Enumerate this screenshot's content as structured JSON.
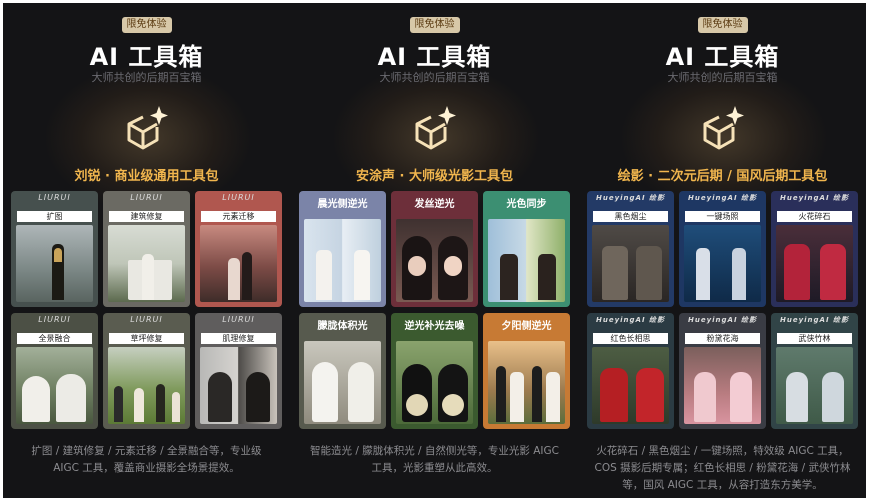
{
  "panels": [
    {
      "badge": "限免体验",
      "title": "AI 工具箱",
      "subtitle": "大师共创的后期百宝箱",
      "package": "刘锐 · 商业级通用工具包",
      "brand": "LIURUI",
      "cards": [
        {
          "label": "扩图"
        },
        {
          "label": "建筑修复"
        },
        {
          "label": "元素迁移"
        },
        {
          "label": "全景融合"
        },
        {
          "label": "草坪修复"
        },
        {
          "label": "肌理修复"
        }
      ],
      "description": "扩图 / 建筑修复 / 元素迁移 / 全景融合等，专业级 AIGC 工具，覆盖商业摄影全场景提效。"
    },
    {
      "badge": "限免体验",
      "title": "AI 工具箱",
      "subtitle": "大师共创的后期百宝箱",
      "package": "安涂声 · 大师级光影工具包",
      "cards": [
        {
          "label": "晨光侧逆光"
        },
        {
          "label": "发丝逆光"
        },
        {
          "label": "光色同步"
        },
        {
          "label": "朦胧体积光"
        },
        {
          "label": "逆光补光去噪"
        },
        {
          "label": "夕阳侧逆光"
        }
      ],
      "description": "智能造光 / 朦胧体积光 / 自然侧光等，专业光影 AIGC 工具，光影重塑从此高效。"
    },
    {
      "badge": "限免体验",
      "title": "AI 工具箱",
      "subtitle": "大师共创的后期百宝箱",
      "package": "绘影 · 二次元后期 / 国风后期工具包",
      "brand": "HueyingAI 绘影",
      "cards": [
        {
          "label": "黑色烟尘"
        },
        {
          "label": "一键场照"
        },
        {
          "label": "火花碎石"
        },
        {
          "label": "红色长相思"
        },
        {
          "label": "粉黛花海"
        },
        {
          "label": "武侠竹林"
        }
      ],
      "description": "火花碎石 / 黑色烟尘 / 一键场照，特效级 AIGC 工具，COS 摄影后期专属；红色长相思 / 粉黛花海 / 武侠竹林等，国风 AIGC 工具，从容打造东方美学。"
    }
  ],
  "colors": {
    "background": "#141416",
    "accent": "#f1b64e",
    "badge_bg": "#d7c8a8"
  },
  "icons": [
    "cube-sparkle-icon"
  ]
}
